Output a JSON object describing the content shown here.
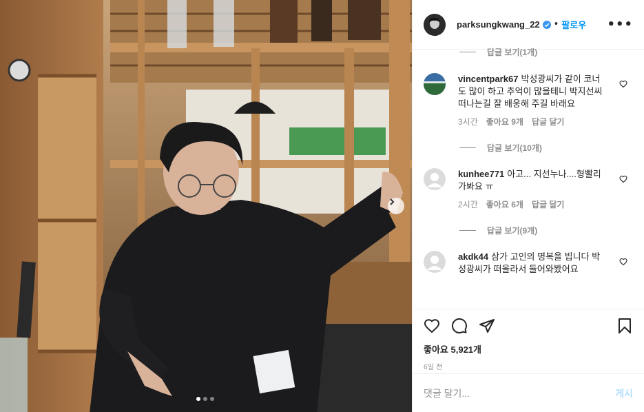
{
  "post": {
    "username": "parksungkwang_22",
    "follow_label": "팔로우",
    "separator": "•",
    "more_label": "•••",
    "verified_icon": "verified-badge-icon"
  },
  "replies_top": {
    "label": "답글 보기(1개)"
  },
  "comments": [
    {
      "username": "vincentpark67",
      "text": "박성광씨가 같이 코너도 많이 하고 추억이 많을테니 박지선씨 떠나는길 잘 배웅해 주길 바래요",
      "time": "3시간",
      "likes": "좋아요 9개",
      "reply": "답글 달기",
      "view_replies": "답글 보기(10개)"
    },
    {
      "username": "kunhee771",
      "text": "아고... 지선누나....형빨리 가봐요 ㅠ",
      "time": "2시간",
      "likes": "좋아요 6개",
      "reply": "답글 달기",
      "view_replies": "답글 보기(9개)"
    },
    {
      "username": "akdk44",
      "text": "삼가 고인의 명복을 빕니다 박성광씨가 떠올라서 들어와봤어요"
    }
  ],
  "footer": {
    "likes": "좋아요 5,921개",
    "ago": "6일 전",
    "comment_placeholder": "댓글 달기...",
    "post_label": "게시"
  },
  "carousel": {
    "count": 3,
    "active": 0
  },
  "colors": {
    "accent": "#0095f6",
    "post_disabled": "#b2dffc",
    "muted": "#8e8e8e"
  }
}
